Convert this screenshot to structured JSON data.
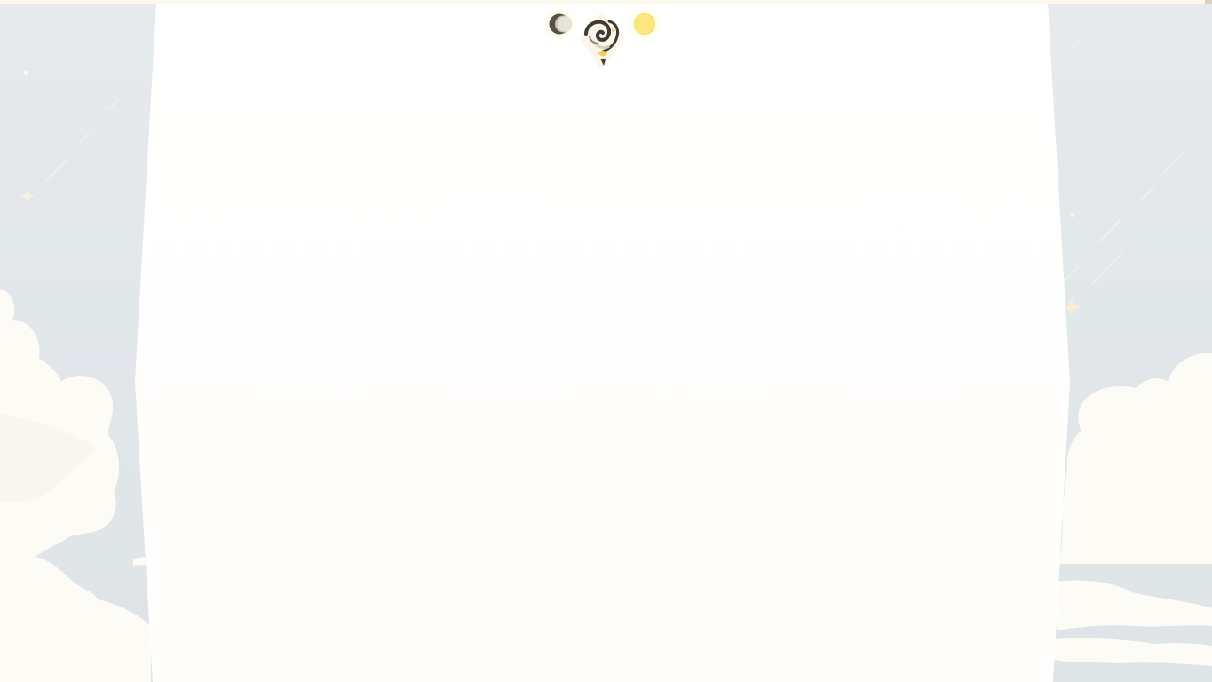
{
  "page": {
    "title": ""
  },
  "theme_switcher": {
    "moon_icon": "moon-icon",
    "sun_icon": "sun-icon",
    "mascot_icon": "mascot-swirl-icon"
  },
  "colors": {
    "sky": "#e3e7ea",
    "cloud": "#fdfbf6",
    "panel": "#fffefd",
    "sun": "#fce680",
    "moon": "#55504a",
    "star": "#f6f1d5"
  }
}
